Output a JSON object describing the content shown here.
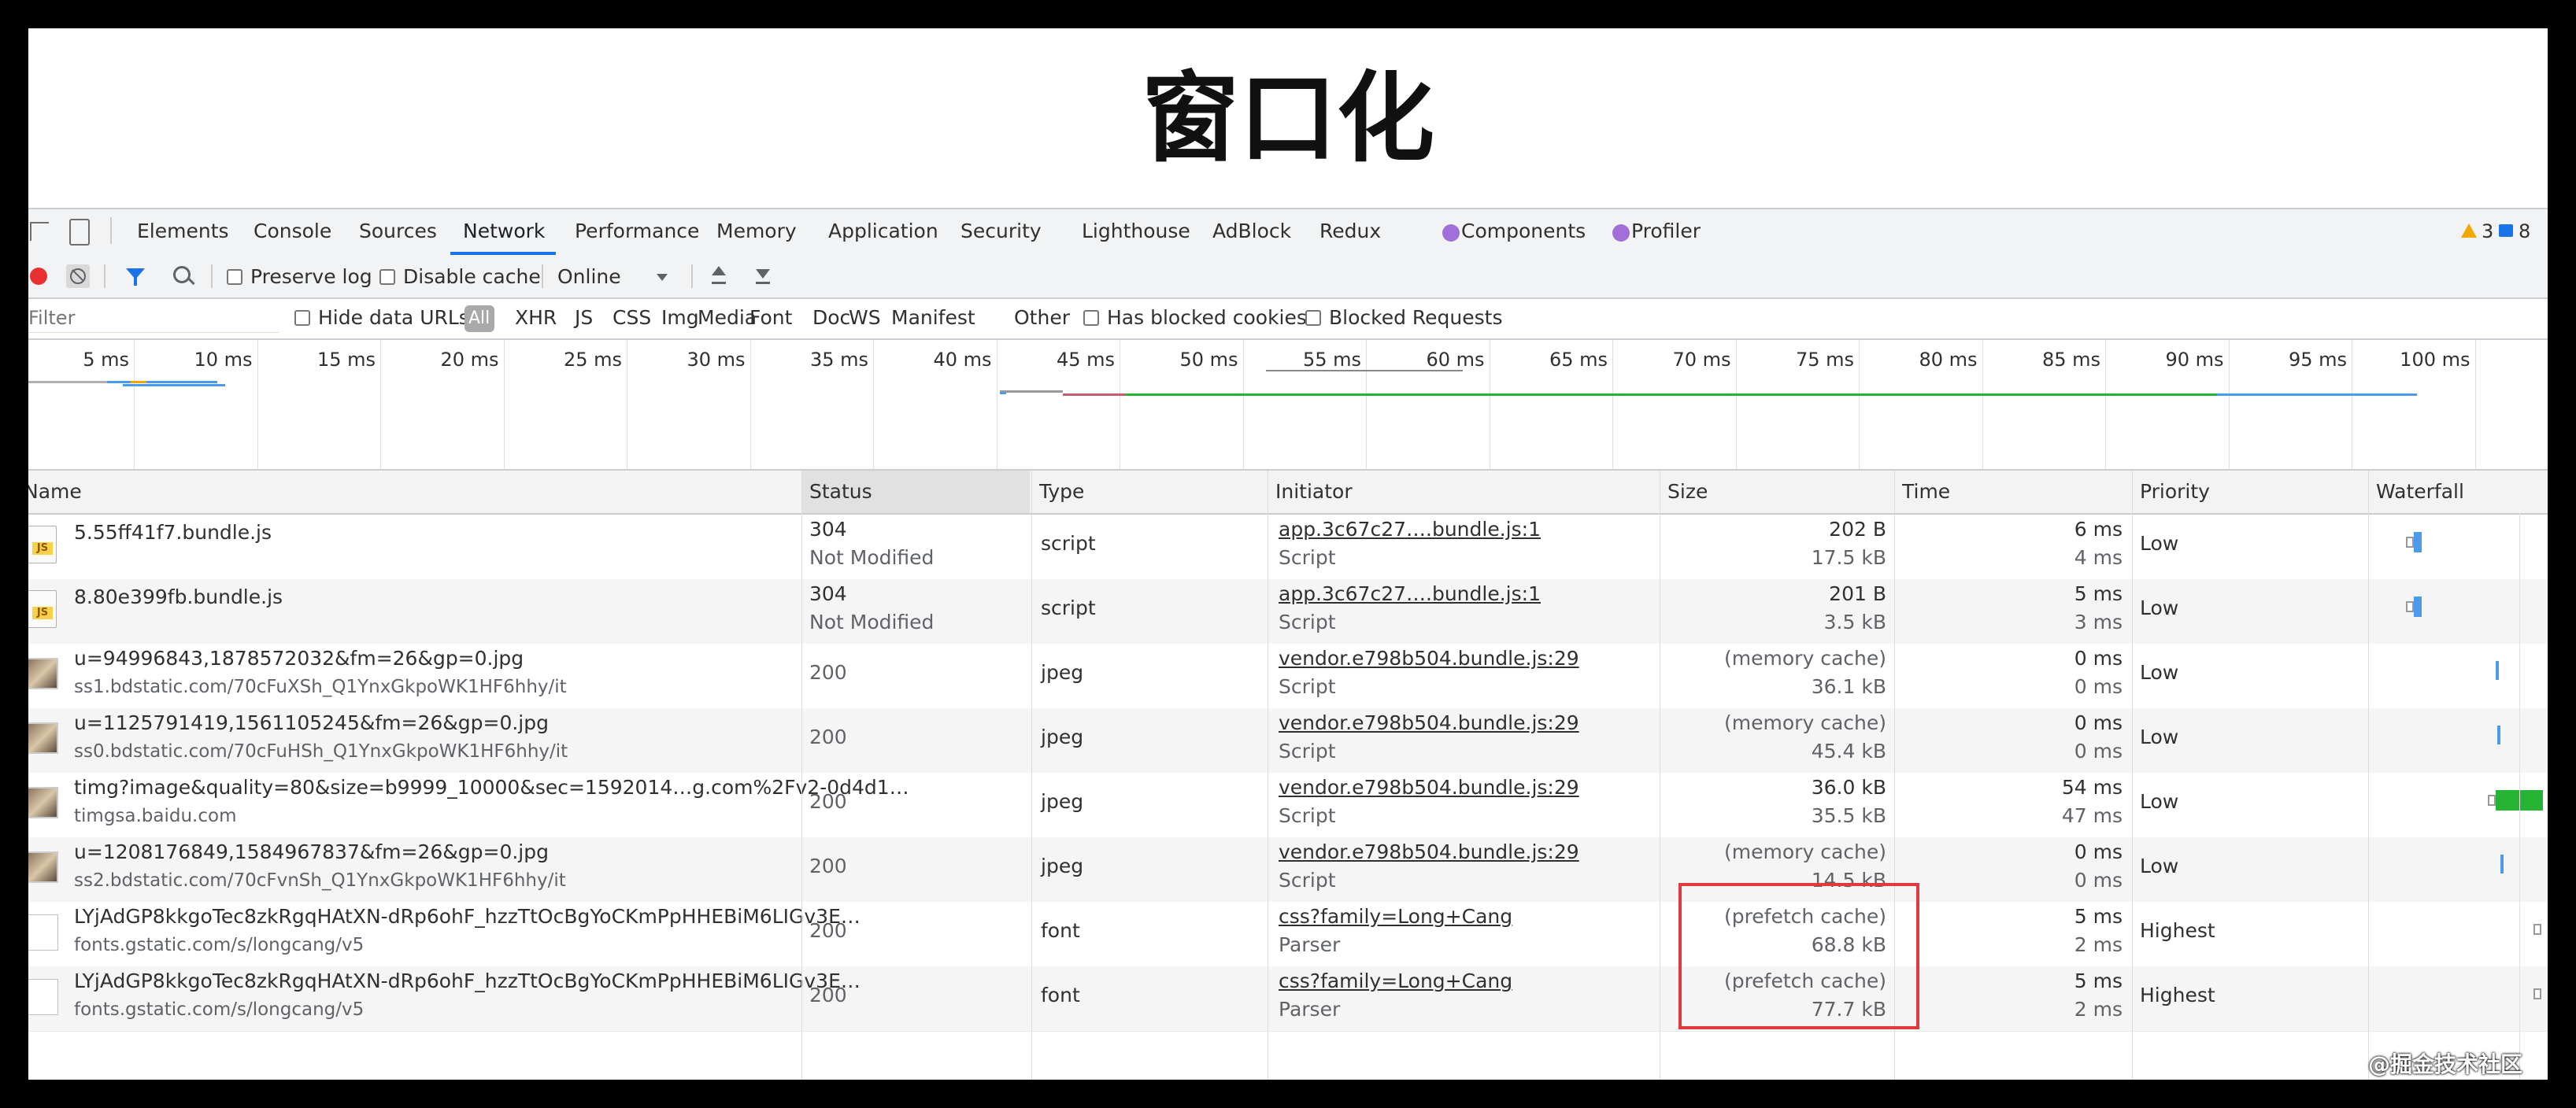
{
  "page_title": "窗口化",
  "tabs": [
    "Elements",
    "Console",
    "Sources",
    "Network",
    "Performance",
    "Memory",
    "Application",
    "Security",
    "Lighthouse",
    "AdBlock",
    "Redux"
  ],
  "react_tabs": [
    "Components",
    "Profiler"
  ],
  "active_tab": "Network",
  "status_counts": {
    "warnings": "3",
    "messages": "8"
  },
  "toolbar": {
    "preserve_log": "Preserve log",
    "disable_cache": "Disable cache",
    "throttle": "Online"
  },
  "filterbar": {
    "placeholder": "Filter",
    "hide_data_urls": "Hide data URLs",
    "all": "All",
    "types": [
      "XHR",
      "JS",
      "CSS",
      "Img",
      "Media",
      "Font",
      "Doc",
      "WS",
      "Manifest",
      "Other"
    ],
    "blocked_cookies": "Has blocked cookies",
    "blocked_requests": "Blocked Requests"
  },
  "timeline_ticks": [
    "5 ms",
    "10 ms",
    "15 ms",
    "20 ms",
    "25 ms",
    "30 ms",
    "35 ms",
    "40 ms",
    "45 ms",
    "50 ms",
    "55 ms",
    "60 ms",
    "65 ms",
    "70 ms",
    "75 ms",
    "80 ms",
    "85 ms",
    "90 ms",
    "95 ms",
    "100 ms",
    "10"
  ],
  "columns": [
    "Name",
    "Status",
    "Type",
    "Initiator",
    "Size",
    "Time",
    "Priority",
    "Waterfall"
  ],
  "rows": [
    {
      "name": "5.55ff41f7.bundle.js",
      "domain": "",
      "status": "304",
      "status_text": "Not Modified",
      "type": "script",
      "initiator": "app.3c67c27….bundle.js:1",
      "initiator_type": "Script",
      "size": "202 B",
      "resource": "17.5 kB",
      "time": "6 ms",
      "latency": "4 ms",
      "priority": "Low",
      "icon": "js-file-icon"
    },
    {
      "name": "8.80e399fb.bundle.js",
      "domain": "",
      "status": "304",
      "status_text": "Not Modified",
      "type": "script",
      "initiator": "app.3c67c27….bundle.js:1",
      "initiator_type": "Script",
      "size": "201 B",
      "resource": "3.5 kB",
      "time": "5 ms",
      "latency": "3 ms",
      "priority": "Low",
      "icon": "js-file-icon"
    },
    {
      "name": "u=94996843,1878572032&fm=26&gp=0.jpg",
      "domain": "ss1.bdstatic.com/70cFuXSh_Q1YnxGkpoWK1HF6hhy/it",
      "status": "200",
      "status_text": "",
      "type": "jpeg",
      "initiator": "vendor.e798b504.bundle.js:29",
      "initiator_type": "Script",
      "size": "(memory cache)",
      "resource": "36.1 kB",
      "time": "0 ms",
      "latency": "0 ms",
      "priority": "Low",
      "icon": "image-thumbnail-icon"
    },
    {
      "name": "u=1125791419,1561105245&fm=26&gp=0.jpg",
      "domain": "ss0.bdstatic.com/70cFuHSh_Q1YnxGkpoWK1HF6hhy/it",
      "status": "200",
      "status_text": "",
      "type": "jpeg",
      "initiator": "vendor.e798b504.bundle.js:29",
      "initiator_type": "Script",
      "size": "(memory cache)",
      "resource": "45.4 kB",
      "time": "0 ms",
      "latency": "0 ms",
      "priority": "Low",
      "icon": "image-thumbnail-icon"
    },
    {
      "name": "timg?image&quality=80&size=b9999_10000&sec=1592014…g.com%2Fv2-0d4d1…",
      "domain": "timgsa.baidu.com",
      "status": "200",
      "status_text": "",
      "type": "jpeg",
      "initiator": "vendor.e798b504.bundle.js:29",
      "initiator_type": "Script",
      "size": "36.0 kB",
      "resource": "35.5 kB",
      "time": "54 ms",
      "latency": "47 ms",
      "priority": "Low",
      "icon": "image-thumbnail-icon"
    },
    {
      "name": "u=1208176849,1584967837&fm=26&gp=0.jpg",
      "domain": "ss2.bdstatic.com/70cFvnSh_Q1YnxGkpoWK1HF6hhy/it",
      "status": "200",
      "status_text": "",
      "type": "jpeg",
      "initiator": "vendor.e798b504.bundle.js:29",
      "initiator_type": "Script",
      "size": "(memory cache)",
      "resource": "14.5 kB",
      "time": "0 ms",
      "latency": "0 ms",
      "priority": "Low",
      "icon": "image-thumbnail-icon"
    },
    {
      "name": "LYjAdGP8kkgoTec8zkRgqHAtXN-dRp6ohF_hzzTtOcBgYoCKmPpHHEBiM6LIGv3E…",
      "domain": "fonts.gstatic.com/s/longcang/v5",
      "status": "200",
      "status_text": "",
      "type": "font",
      "initiator": "css?family=Long+Cang",
      "initiator_type": "Parser",
      "size": "(prefetch cache)",
      "resource": "68.8 kB",
      "time": "5 ms",
      "latency": "2 ms",
      "priority": "Highest",
      "icon": "blank-file-icon"
    },
    {
      "name": "LYjAdGP8kkgoTec8zkRgqHAtXN-dRp6ohF_hzzTtOcBgYoCKmPpHHEBiM6LIGv3E…",
      "domain": "fonts.gstatic.com/s/longcang/v5",
      "status": "200",
      "status_text": "",
      "type": "font",
      "initiator": "css?family=Long+Cang",
      "initiator_type": "Parser",
      "size": "(prefetch cache)",
      "resource": "77.7 kB",
      "time": "5 ms",
      "latency": "2 ms",
      "priority": "Highest",
      "icon": "blank-file-icon"
    }
  ],
  "watermark": "@掘金技术社区",
  "colors": {
    "accent": "#1a73e8",
    "record": "#e8312f",
    "highlight_box": "#e0393e",
    "connection": "#27b434",
    "bar_blue": "#4b9bea"
  }
}
